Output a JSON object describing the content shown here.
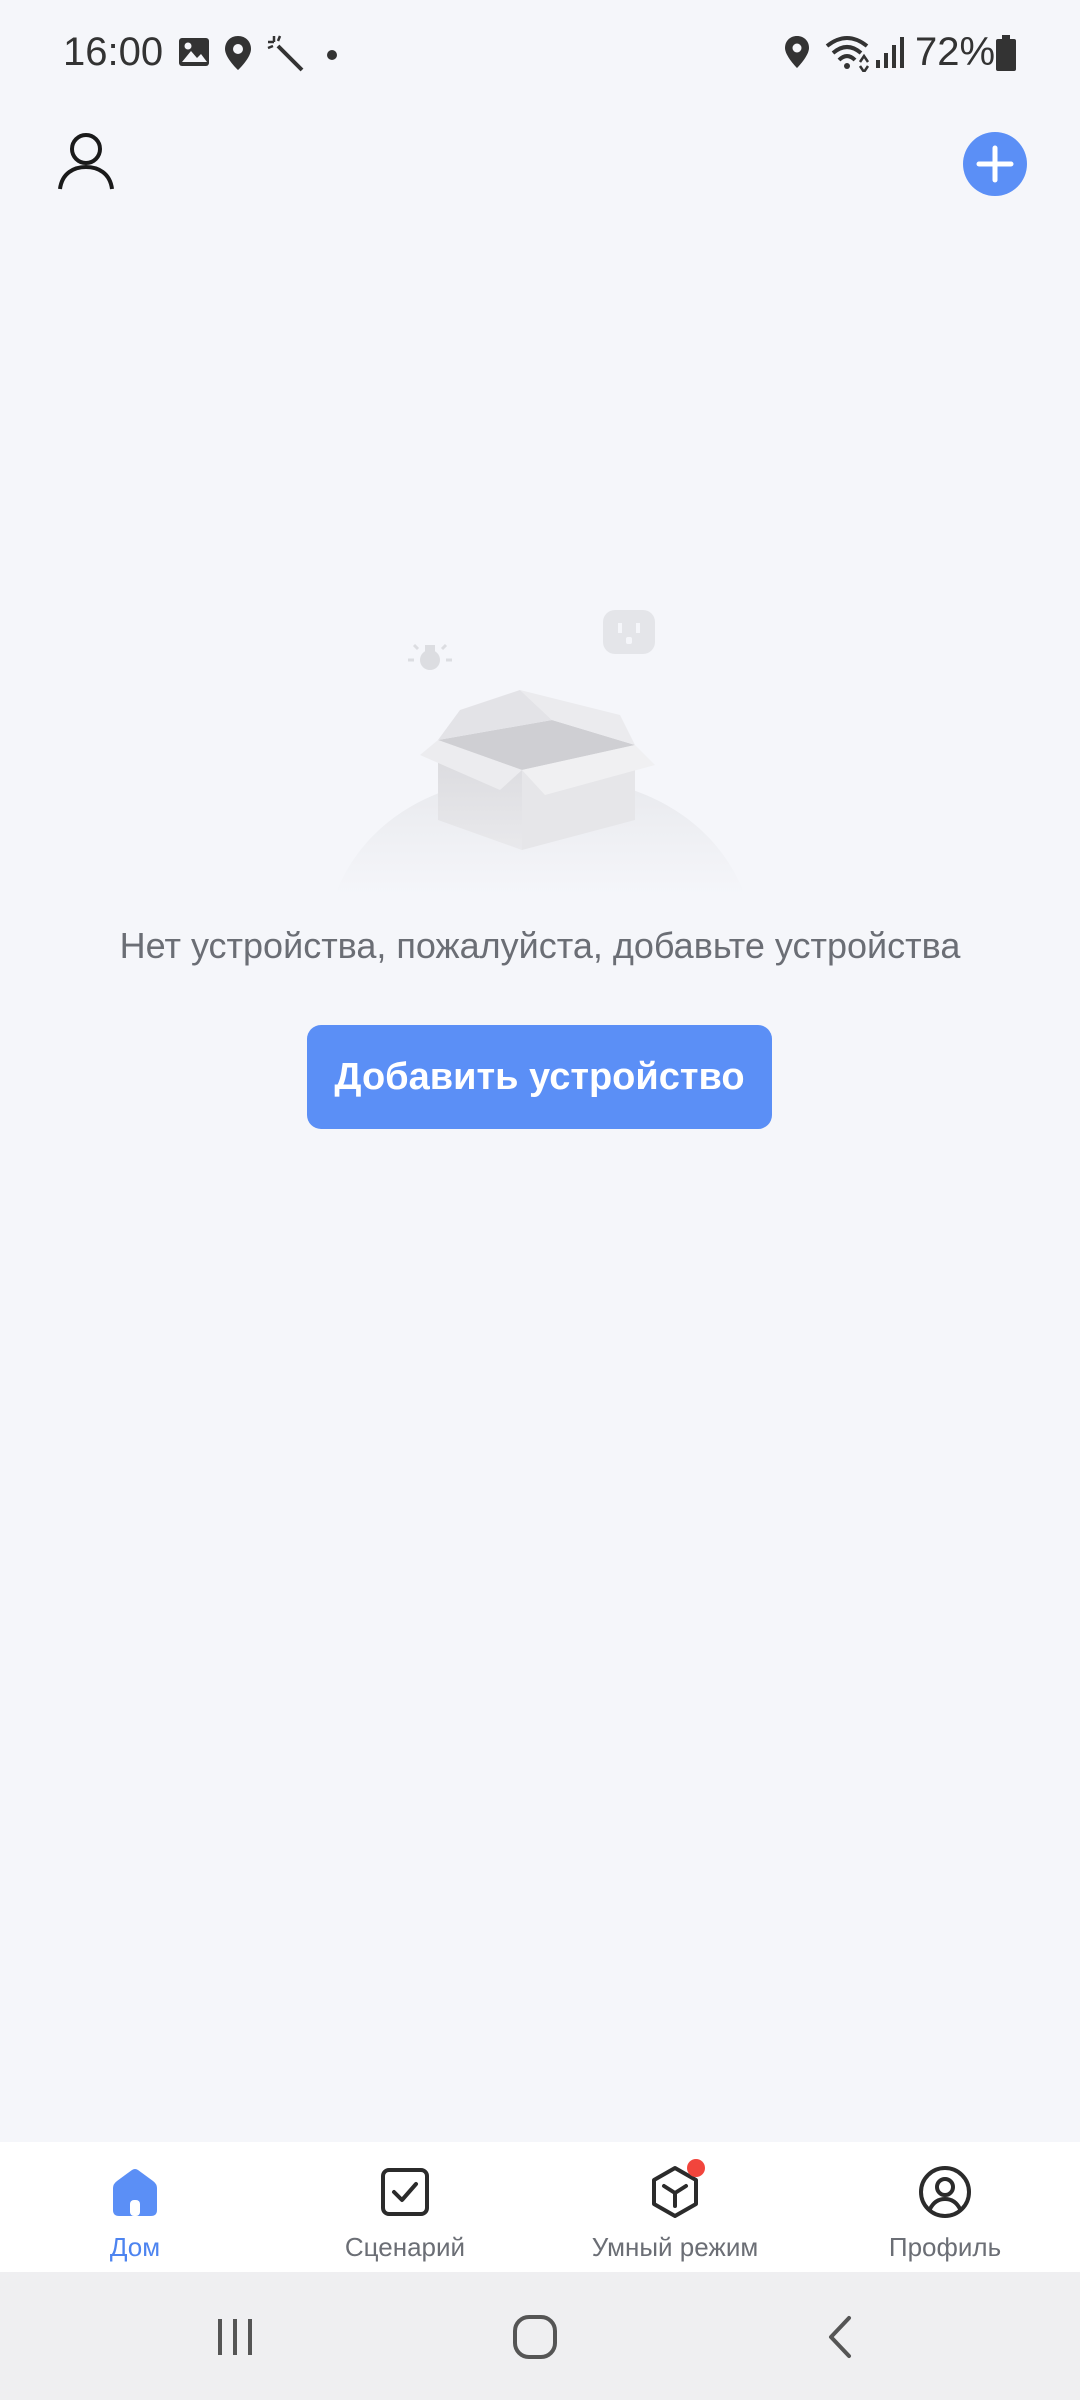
{
  "status_bar": {
    "time": "16:00",
    "battery_percent": "72%",
    "left_icons": [
      "gallery-icon",
      "location-pin-icon",
      "magic-wand-icon",
      "dot-icon"
    ],
    "right_icons": [
      "location-icon",
      "wifi-icon",
      "signal-icon",
      "battery-icon"
    ]
  },
  "top_bar": {
    "profile_icon": "user-outline-icon",
    "add_icon": "plus-icon"
  },
  "empty_state": {
    "message": "Нет устройства, пожалуйста, добавьте устройства",
    "button_label": "Добавить устройство"
  },
  "bottom_nav": {
    "items": [
      {
        "label": "Дом",
        "icon": "home-icon",
        "active": true
      },
      {
        "label": "Сценарий",
        "icon": "scenario-checkbox-icon",
        "active": false
      },
      {
        "label": "Умный режим",
        "icon": "smart-cube-icon",
        "active": false,
        "badge": true
      },
      {
        "label": "Профиль",
        "icon": "profile-circle-icon",
        "active": false
      }
    ]
  },
  "system_nav": [
    "recents-button",
    "home-button",
    "back-button"
  ],
  "colors": {
    "background": "#f5f6fa",
    "accent": "#5b8ff6",
    "badge": "#f2453c",
    "text_muted": "#6b6e75"
  }
}
